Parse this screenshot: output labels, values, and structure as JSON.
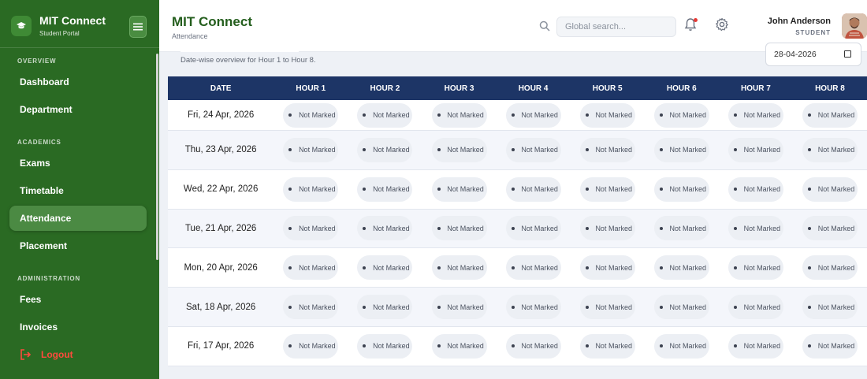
{
  "brand": {
    "title": "MIT Connect",
    "subtitle": "Student Portal"
  },
  "sidebar": {
    "sections": [
      {
        "label": "OVERVIEW",
        "items": [
          "Dashboard",
          "Department"
        ]
      },
      {
        "label": "ACADEMICS",
        "items": [
          "Exams",
          "Timetable",
          "Attendance",
          "Placement"
        ]
      },
      {
        "label": "ADMINISTRATION",
        "items": [
          "Fees",
          "Invoices"
        ]
      }
    ],
    "active": "Attendance",
    "logout_label": "Logout"
  },
  "header": {
    "title": "MIT Connect",
    "subtitle": "Attendance",
    "search_placeholder": "Global search...",
    "user_name": "John Anderson",
    "user_role": "STUDENT"
  },
  "card": {
    "description": "Date-wise overview for Hour 1 to Hour 8.",
    "date_value": "28-04-2026"
  },
  "table": {
    "headers": [
      "DATE",
      "HOUR 1",
      "HOUR 2",
      "HOUR 3",
      "HOUR 4",
      "HOUR 5",
      "HOUR 6",
      "HOUR 7",
      "HOUR 8"
    ],
    "status_label": "Not Marked",
    "rows": [
      {
        "date": "Fri, 24 Apr, 2026"
      },
      {
        "date": "Thu, 23 Apr, 2026"
      },
      {
        "date": "Wed, 22 Apr, 2026"
      },
      {
        "date": "Tue, 21 Apr, 2026"
      },
      {
        "date": "Mon, 20 Apr, 2026"
      },
      {
        "date": "Sat, 18 Apr, 2026"
      },
      {
        "date": "Fri, 17 Apr, 2026"
      }
    ]
  },
  "colors": {
    "sidebar": "#2a6a23",
    "header_table": "#1d3566",
    "accent_title": "#245e1d",
    "logout": "#ff4a3d"
  }
}
